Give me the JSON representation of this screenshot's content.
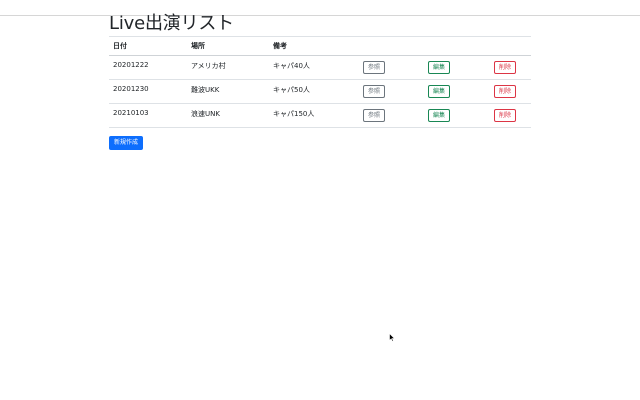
{
  "page": {
    "title": "Live出演リスト"
  },
  "table": {
    "headers": [
      "日付",
      "場所",
      "備考"
    ],
    "rows": [
      {
        "date": "20201222",
        "place": "アメリカ村",
        "note": "キャパ40人"
      },
      {
        "date": "20201230",
        "place": "難波UKK",
        "note": "キャパ50人"
      },
      {
        "date": "20210103",
        "place": "浪速UNK",
        "note": "キャパ150人"
      }
    ],
    "actions": {
      "view": "参照",
      "edit": "編集",
      "delete": "削除"
    }
  },
  "create_button": "新規作成",
  "colors": {
    "primary": "#0d6efd",
    "secondary": "#6c757d",
    "success": "#198754",
    "danger": "#dc3545"
  },
  "icons": {
    "cursor": "mouse-pointer-icon"
  }
}
